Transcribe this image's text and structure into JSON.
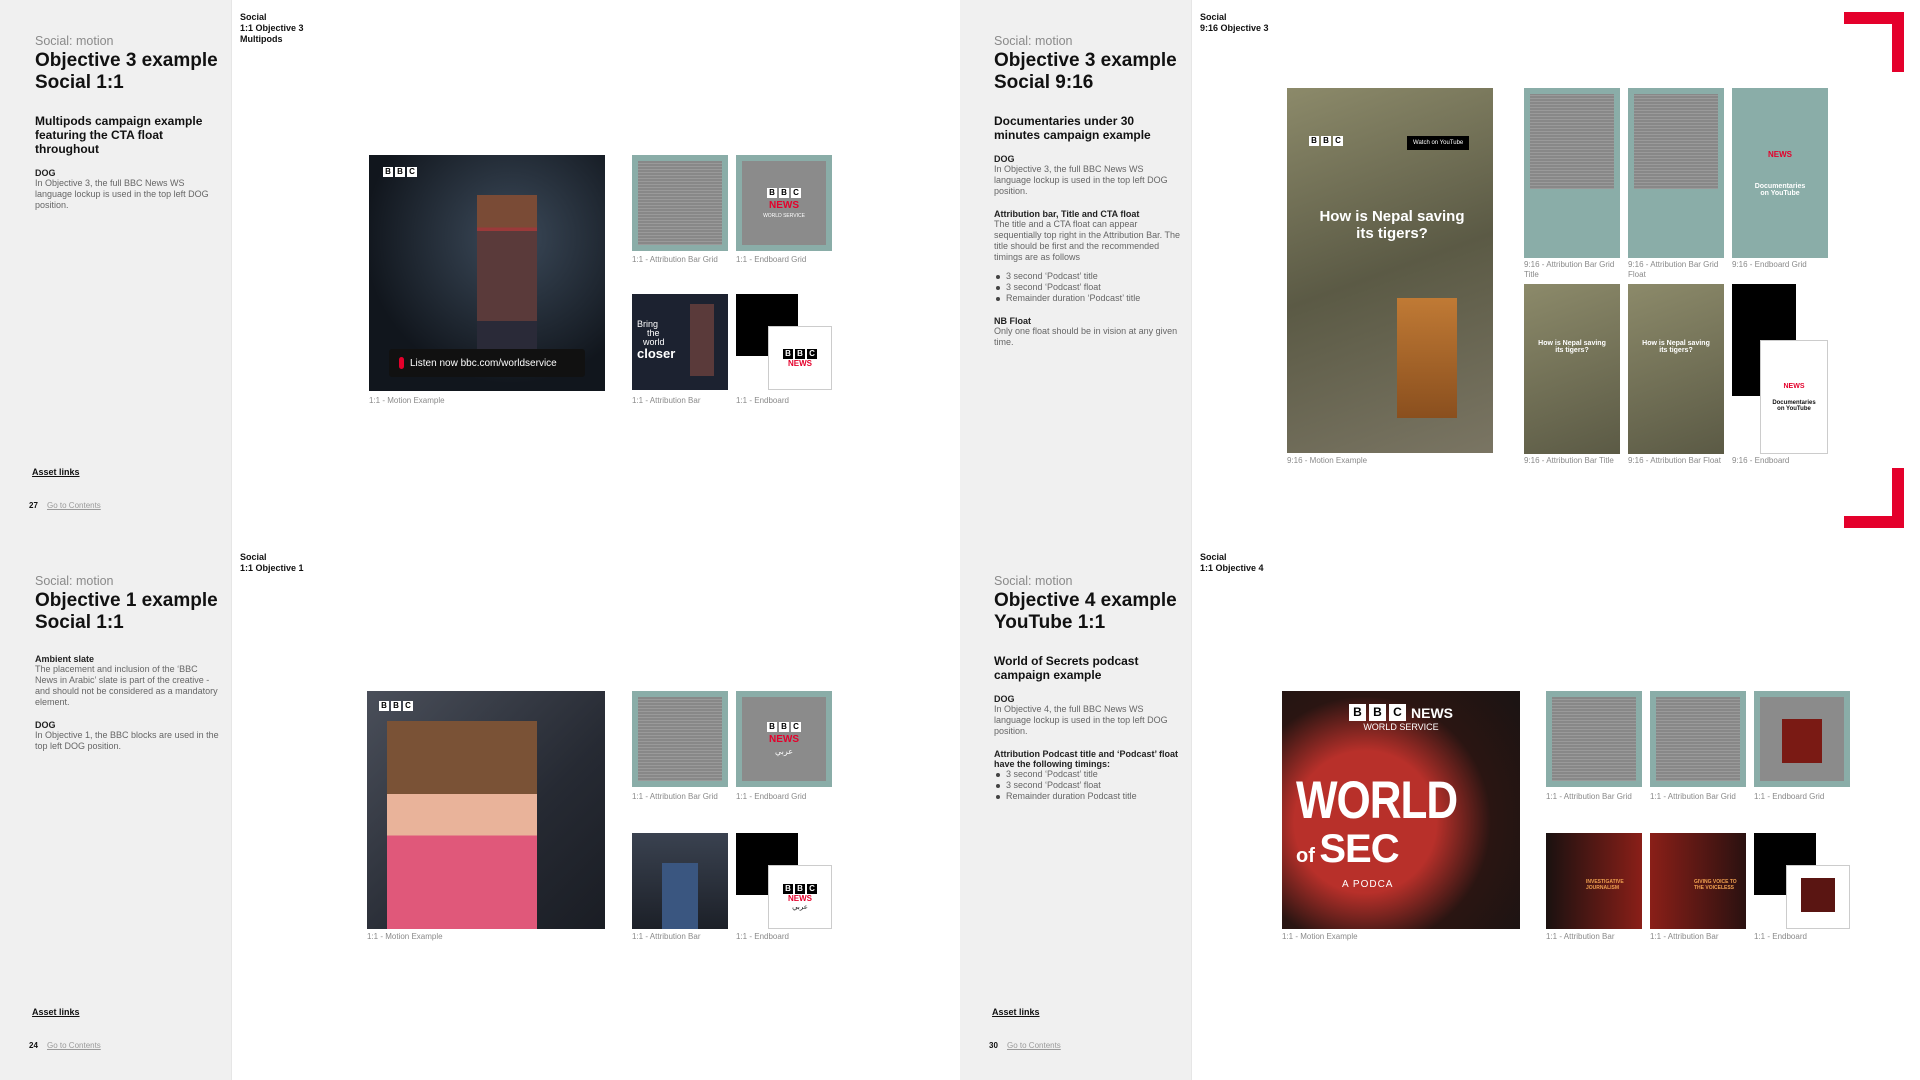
{
  "p27": {
    "eyebrow": "Social: motion",
    "title1": "Objective 3 example",
    "title2": "Social 1:1",
    "subtitle": "Multipods campaign example featuring the CTA float throughout",
    "dog_h": "DOG",
    "dog_t": "In Objective 3, the full BBC News WS language lockup is used in the top left DOG position.",
    "asset": "Asset links",
    "num": "27",
    "goto": "Go to Contents",
    "sect1": "Social",
    "sect2": "1:1 Objective 3",
    "sect3": "Multipods",
    "cta": "Listen now bbc.com/worldservice",
    "cap_motion": "1:1 - Motion Example",
    "cap_abg": "1:1 - Attribution Bar Grid",
    "cap_eg": "1:1 - Endboard Grid",
    "cap_ab": "1:1 - Attribution Bar",
    "cap_e": "1:1 - Endboard",
    "bring1": "Bring",
    "bring2": "the",
    "bring3": "world",
    "bring4": "closer"
  },
  "p28": {
    "eyebrow": "Social: motion",
    "title1": "Objective 3 example",
    "title2": "Social 9:16",
    "subtitle": "Documentaries under 30 minutes campaign example",
    "dog_h": "DOG",
    "dog_t": "In Objective 3, the full BBC News WS language lockup is used in the top left DOG position.",
    "attr_h": "Attribution bar, Title and CTA float",
    "attr_t": "The title and a CTA float can appear sequentially top right in the Attribution Bar. The title should be first and the recommended timings are as follows",
    "b1": "3 second ‘Podcast’ title",
    "b2": "3 second ‘Podcast’ float",
    "b3": "Remainder duration ‘Podcast’ title",
    "nb_h": "NB Float",
    "nb_t": "Only one float should be in vision at any given time.",
    "sect1": "Social",
    "sect2": "9:16 Objective 3",
    "headline": "How is Nepal saving its tigers?",
    "yt": "Watch on YouTube",
    "docs": "Documentaries on YouTube",
    "cap_motion": "9:16 - Motion Example",
    "cap_abgt": "9:16 - Attribution Bar Grid Title",
    "cap_abgf": "9:16 - Attribution Bar Grid Float",
    "cap_eg": "9:16 - Endboard Grid",
    "cap_abt": "9:16 - Attribution Bar Title",
    "cap_abf": "9:16 - Attribution Bar Float",
    "cap_e": "9:16 - Endboard"
  },
  "p24": {
    "eyebrow": "Social: motion",
    "title1": "Objective 1 example",
    "title2": "Social 1:1",
    "amb_h": "Ambient slate",
    "amb_t": "The placement and inclusion of the ‘BBC News in Arabic’ slate is part of the creative - and should not be considered as a mandatory element.",
    "dog_h": "DOG",
    "dog_t": "In Objective 1, the BBC blocks are used in the top left DOG position.",
    "asset": "Asset links",
    "num": "24",
    "goto": "Go to Contents",
    "sect1": "Social",
    "sect2": "1:1 Objective 1",
    "cap_motion": "1:1 - Motion Example",
    "cap_abg": "1:1 - Attribution Bar Grid",
    "cap_eg": "1:1 - Endboard Grid",
    "cap_ab": "1:1 - Attribution Bar",
    "cap_e": "1:1 - Endboard",
    "arabic": "عربي"
  },
  "p30": {
    "eyebrow": "Social: motion",
    "title1": "Objective 4 example",
    "title2": "YouTube 1:1",
    "subtitle": "World of Secrets podcast campaign example",
    "dog_h": "DOG",
    "dog_t": "In Objective 4, the full BBC News WS language lockup is used in the top left DOG position.",
    "attr_h": "Attribution Podcast title and ‘Podcast’ float have the following timings:",
    "b1": "3 second ‘Podcast’ title",
    "b2": "3 second ‘Podcast’ float",
    "b3": "Remainder duration Podcast title",
    "asset": "Asset links",
    "num": "30",
    "goto": "Go to Contents",
    "sect1": "Social",
    "sect2": "1:1 Objective 4",
    "news": "NEWS",
    "ws": "WORLD SERVICE",
    "world": "WORLD",
    "of": "of",
    "sec": "SEC",
    "podcast": "A PODCA",
    "cap_motion": "1:1 - Motion Example",
    "cap_abg": "1:1 - Attribution Bar Grid",
    "cap_eg": "1:1 - Endboard Grid",
    "cap_ab": "1:1 - Attribution Bar",
    "cap_e": "1:1 - Endboard",
    "ij": "INVESTIGATIVE JOURNALISM",
    "gv": "GIVING VOICE TO THE VOICELESS"
  }
}
